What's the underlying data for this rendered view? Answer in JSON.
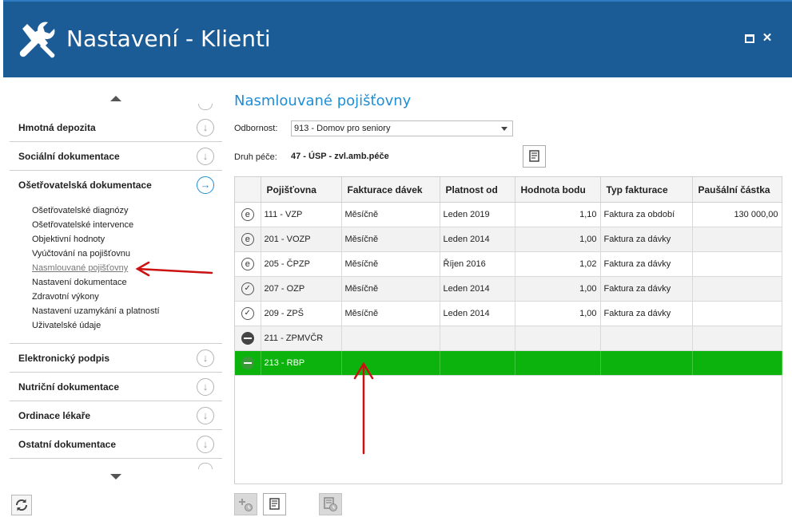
{
  "window": {
    "title": "Nastavení - Klienti",
    "app_icon": "tools-icon"
  },
  "sidebar": {
    "sections_top": [
      {
        "label": "Hmotná depozita",
        "icon": "down-arrow-circle"
      },
      {
        "label": "Sociální dokumentace",
        "icon": "down-arrow-circle"
      },
      {
        "label": "Ošetřovatelská dokumentace",
        "icon": "right-arrow-circle",
        "active": true
      }
    ],
    "subitems": [
      {
        "label": "Ošetřovatelské diagnózy"
      },
      {
        "label": "Ošetřovatelské intervence"
      },
      {
        "label": "Objektivní hodnoty"
      },
      {
        "label": "Vyúčtování na pojišťovnu"
      },
      {
        "label": "Nasmlouvané pojišťovny",
        "selected": true
      },
      {
        "label": "Nastavení dokumentace"
      },
      {
        "label": "Zdravotní výkony"
      },
      {
        "label": "Nastavení uzamykání a platností"
      },
      {
        "label": "Uživatelské údaje"
      }
    ],
    "sections_bottom": [
      {
        "label": "Elektronický podpis",
        "icon": "down-arrow-circle"
      },
      {
        "label": "Nutriční dokumentace",
        "icon": "down-arrow-circle"
      },
      {
        "label": "Ordinace lékaře",
        "icon": "down-arrow-circle"
      },
      {
        "label": "Ostatní dokumentace",
        "icon": "down-arrow-circle"
      }
    ]
  },
  "main": {
    "title": "Nasmlouvané pojišťovny",
    "odbornost_label": "Odbornost:",
    "odbornost_value": "913 - Domov pro seniory",
    "druh_label": "Druh péče:",
    "druh_value": "47 - ÚSP - zvl.amb.péče"
  },
  "grid": {
    "columns": [
      "",
      "Pojišťovna",
      "Fakturace dávek",
      "Platnost od",
      "Hodnota bodu",
      "Typ fakturace",
      "Paušální částka"
    ],
    "rows": [
      {
        "icon": "e",
        "pojistovna": "111 - VZP",
        "fakturace": "Měsíčně",
        "platnost": "Leden 2019",
        "hodnota": "1,10",
        "typ": "Faktura za období",
        "pausal": "130 000,00"
      },
      {
        "icon": "e",
        "pojistovna": "201 - VOZP",
        "fakturace": "Měsíčně",
        "platnost": "Leden 2014",
        "hodnota": "1,00",
        "typ": "Faktura za dávky",
        "pausal": ""
      },
      {
        "icon": "e",
        "pojistovna": "205 - ČPZP",
        "fakturace": "Měsíčně",
        "platnost": "Říjen 2016",
        "hodnota": "1,02",
        "typ": "Faktura za dávky",
        "pausal": ""
      },
      {
        "icon": "check",
        "pojistovna": "207 - OZP",
        "fakturace": "Měsíčně",
        "platnost": "Leden 2014",
        "hodnota": "1,00",
        "typ": "Faktura za dávky",
        "pausal": ""
      },
      {
        "icon": "check",
        "pojistovna": "209 - ZPŠ",
        "fakturace": "Měsíčně",
        "platnost": "Leden 2014",
        "hodnota": "1,00",
        "typ": "Faktura za dávky",
        "pausal": ""
      },
      {
        "icon": "minus",
        "pojistovna": "211 - ZPMVČR",
        "fakturace": "",
        "platnost": "",
        "hodnota": "",
        "typ": "",
        "pausal": ""
      },
      {
        "icon": "minus",
        "pojistovna": "213 - RBP",
        "fakturace": "",
        "platnost": "",
        "hodnota": "",
        "typ": "",
        "pausal": "",
        "selected": true
      }
    ]
  },
  "colors": {
    "titlebar": "#1b5b96",
    "accent": "#1e8ed6",
    "selected_row": "#0db30d",
    "annotation": "#cc1111"
  }
}
